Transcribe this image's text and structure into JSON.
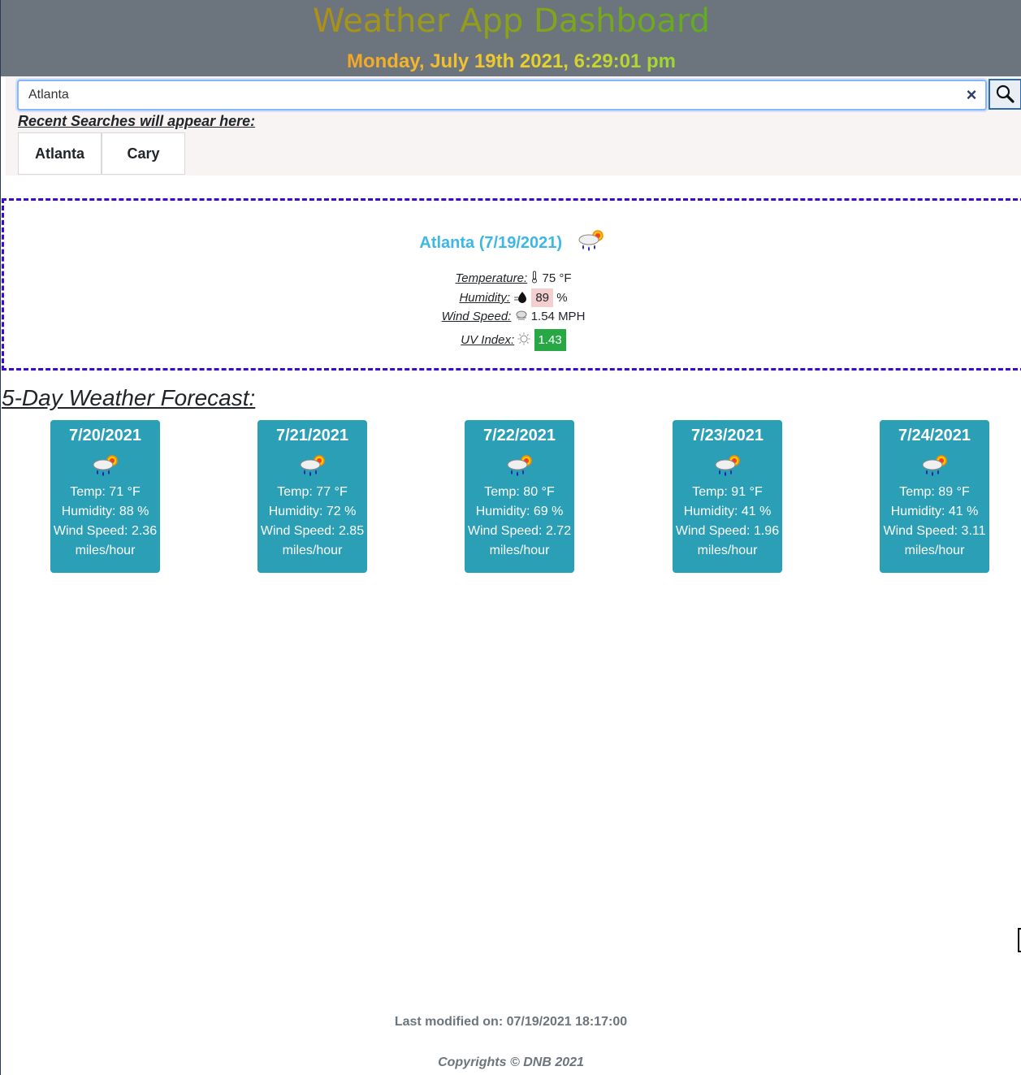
{
  "header": {
    "title": "Weather App Dashboard",
    "datetime": "Monday, July 19th 2021, 6:29:01 pm"
  },
  "search": {
    "value": "Atlanta",
    "clear_glyph": "×",
    "search_icon": "magnifier-icon"
  },
  "recent": {
    "label": "Recent Searches will appear here:",
    "items": [
      "Atlanta",
      "Cary"
    ]
  },
  "current": {
    "title": "Atlanta (7/19/2021)",
    "icon": "rain-sun-icon",
    "temperature_label": "Temperature:",
    "temperature_value": "75 °F",
    "humidity_label": "Humidity:",
    "humidity_value": "89",
    "humidity_unit": "%",
    "wind_label": "Wind Speed:",
    "wind_value": "1.54 MPH",
    "uv_label": "UV Index:",
    "uv_value": "1.43",
    "uv_color": "#28a745"
  },
  "forecast": {
    "title": "5-Day Weather Forecast:",
    "card_color": "#2a9fb6",
    "days": [
      {
        "date": "7/20/2021",
        "temp": "Temp: 71 °F",
        "humidity": "Humidity: 88 %",
        "wind": "Wind Speed: 2.36",
        "wind_unit": "miles/hour"
      },
      {
        "date": "7/21/2021",
        "temp": "Temp: 77 °F",
        "humidity": "Humidity: 72 %",
        "wind": "Wind Speed: 2.85",
        "wind_unit": "miles/hour"
      },
      {
        "date": "7/22/2021",
        "temp": "Temp: 80 °F",
        "humidity": "Humidity: 69 %",
        "wind": "Wind Speed: 2.72",
        "wind_unit": "miles/hour"
      },
      {
        "date": "7/23/2021",
        "temp": "Temp: 91 °F",
        "humidity": "Humidity: 41 %",
        "wind": "Wind Speed: 1.96",
        "wind_unit": "miles/hour"
      },
      {
        "date": "7/24/2021",
        "temp": "Temp: 89 °F",
        "humidity": "Humidity: 41 %",
        "wind": "Wind Speed: 3.11",
        "wind_unit": "miles/hour"
      }
    ]
  },
  "footer": {
    "modified": "Last modified on: 07/19/2021 18:17:00",
    "copyright": "Copyrights © DNB 2021"
  }
}
